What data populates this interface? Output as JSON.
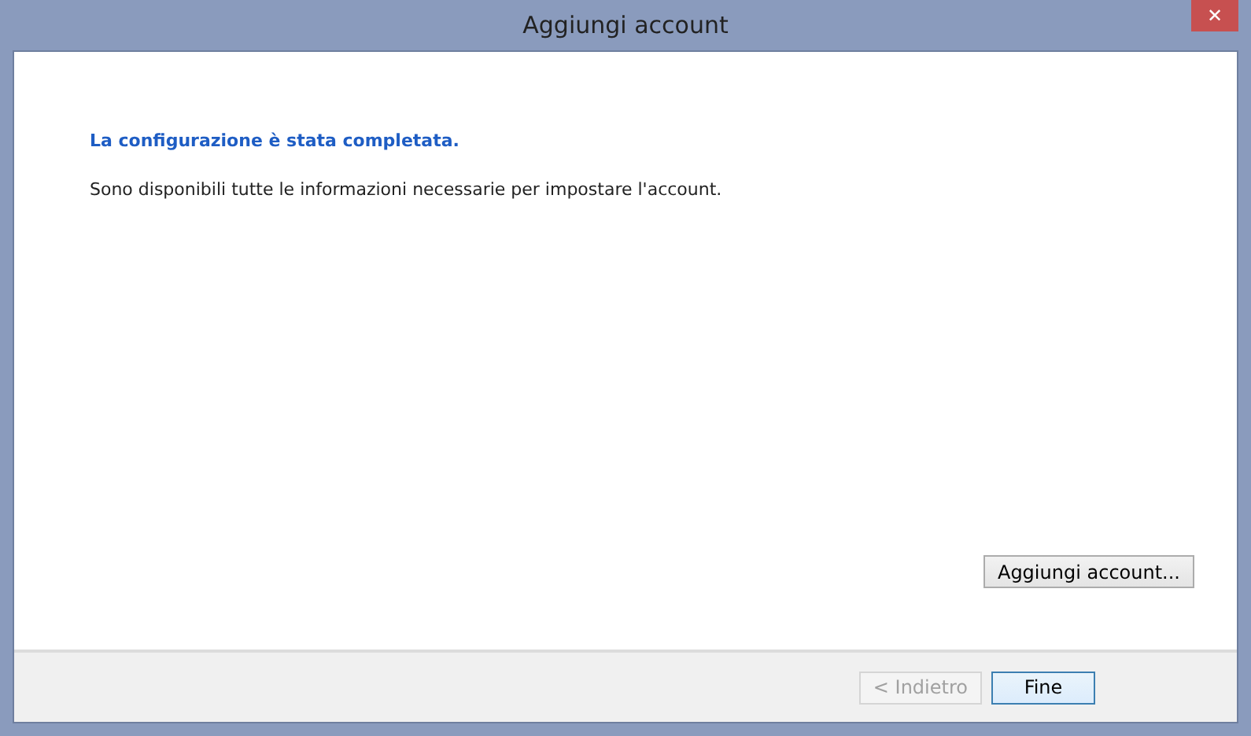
{
  "window": {
    "title": "Aggiungi account",
    "close_label": "✕"
  },
  "heading": "La configurazione è stata completata.",
  "message": "Sono disponibili tutte le informazioni necessarie per impostare l'account.",
  "add_button": {
    "label": "Aggiungi account...",
    "disabled": false,
    "focused": false
  },
  "buttons": [
    {
      "label": "< Indietro",
      "disabled": true,
      "focused": false
    },
    {
      "label": "Fine",
      "disabled": false,
      "focused": true
    }
  ]
}
